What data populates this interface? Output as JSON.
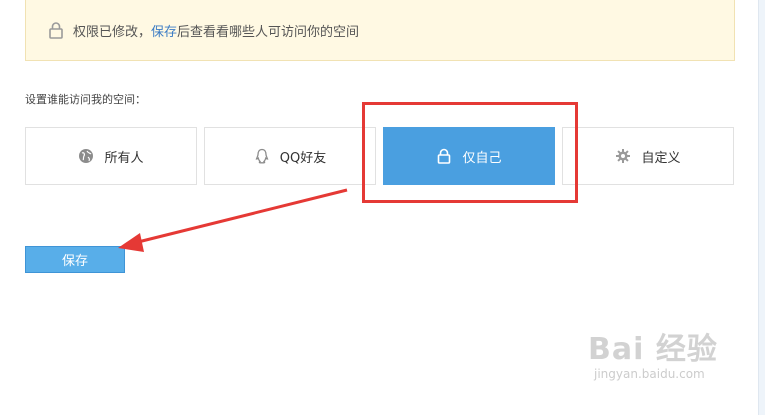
{
  "notice": {
    "prefix": "权限已修改，",
    "link": "保存",
    "suffix": "后查看看哪些人可访问你的空间",
    "lock_icon": "lock-icon"
  },
  "section_label": "设置谁能访问我的空间：",
  "options": [
    {
      "label": "所有人",
      "icon": "globe-icon",
      "selected": false
    },
    {
      "label": "QQ好友",
      "icon": "qq-penguin-icon",
      "selected": false
    },
    {
      "label": "仅自己",
      "icon": "lock-icon",
      "selected": true
    },
    {
      "label": "自定义",
      "icon": "gear-icon",
      "selected": false
    }
  ],
  "save_button": {
    "label": "保存"
  },
  "watermark": {
    "main": "Bai 经验",
    "sub": "jingyan.baidu.com"
  },
  "colors": {
    "selected_bg": "#4a9fe0",
    "notice_bg": "#fff9e3",
    "link": "#3b7cc4",
    "annotation_red": "#e53935",
    "save_bg": "#58aee9"
  }
}
